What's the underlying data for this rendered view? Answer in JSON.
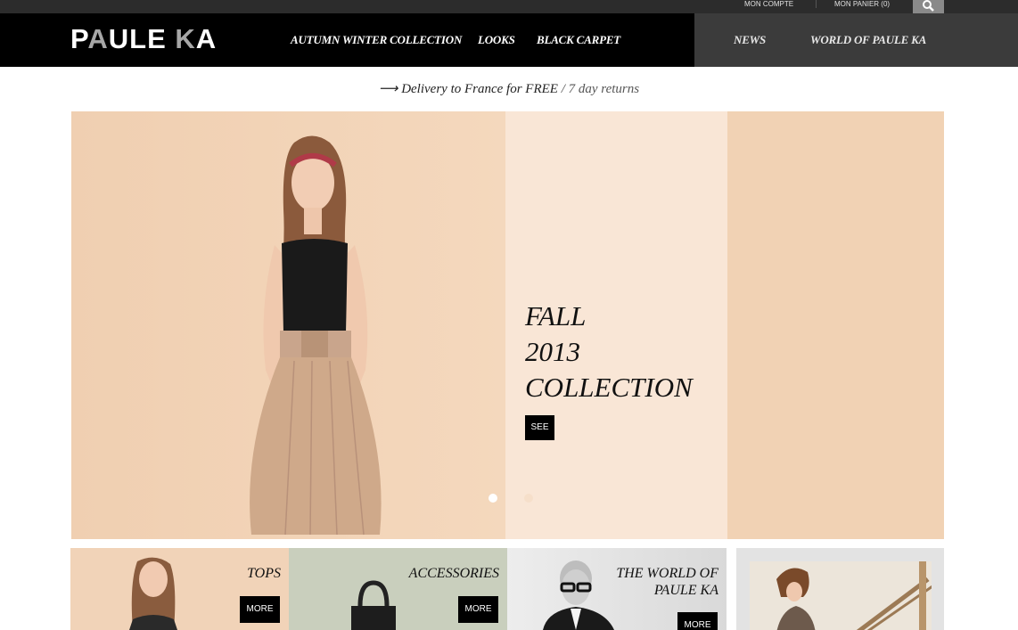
{
  "utility": {
    "account_label": "MON COMPTE",
    "cart_label": "MON PANIER (0)"
  },
  "header": {
    "logo_part1": "P",
    "logo_part2": "A",
    "logo_part3": "ULE ",
    "logo_part4": "K",
    "logo_part5": "A",
    "nav": [
      {
        "label": "AUTUMN WINTER COLLECTION"
      },
      {
        "label": "LOOKS"
      },
      {
        "label": "BLACK CARPET"
      },
      {
        "label": "NEWS"
      },
      {
        "label": "WORLD OF PAULE KA"
      }
    ]
  },
  "promo": {
    "arrow": "⟶",
    "text": " Delivery to France for FREE ",
    "slash_returns": "/ 7 day returns"
  },
  "hero": {
    "heading_line1": "FALL",
    "heading_line2": "2013",
    "heading_line3": "COLLECTION",
    "see_label": "SEE",
    "active_slide": 1,
    "slide_count": 2
  },
  "tiles": [
    {
      "title": "TOPS",
      "more_label": "MORE"
    },
    {
      "title": "ACCESSORIES",
      "more_label": "MORE"
    },
    {
      "title_line1": "THE WORLD OF",
      "title_line2": "PAULE KA",
      "more_label": "MORE"
    }
  ],
  "colors": {
    "header_black": "#000000",
    "header_grey": "#3b3b3b",
    "hero_peach": "#f1d3b6",
    "hero_cream": "#f9e6d6"
  }
}
